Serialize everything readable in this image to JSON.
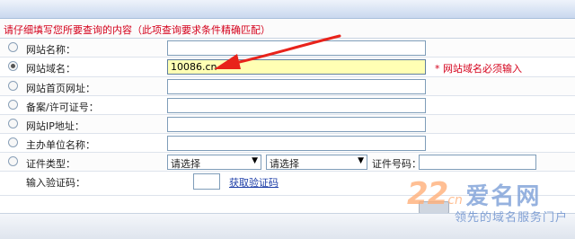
{
  "notice": "请仔细填写您所要查询的内容（此项查询要求条件精确匹配）",
  "rows": [
    {
      "label": "网站名称：",
      "value": "",
      "checked": false
    },
    {
      "label": "网站域名：",
      "value": "10086.cn",
      "checked": true
    },
    {
      "label": "网站首页网址：",
      "value": "",
      "checked": false
    },
    {
      "label": "备案/许可证号：",
      "value": "",
      "checked": false
    },
    {
      "label": "网站IP地址：",
      "value": "",
      "checked": false
    },
    {
      "label": "主办单位名称：",
      "value": "",
      "checked": false
    }
  ],
  "required_note": "* 网站域名必须输入",
  "cert": {
    "label": "证件类型：",
    "select1": "请选择",
    "select2": "请选择",
    "number_label": "证件号码："
  },
  "captcha": {
    "label": "输入验证码：",
    "link": "获取验证码"
  },
  "watermark": {
    "number": "22",
    "tld": "cn",
    "name": "爱名网",
    "slogan": "领先的域名服务门户"
  },
  "colors": {
    "notice": "#d4001b",
    "highlight": "#ffffb4",
    "arrow": "#e8231b",
    "link": "#1f3fa8"
  }
}
